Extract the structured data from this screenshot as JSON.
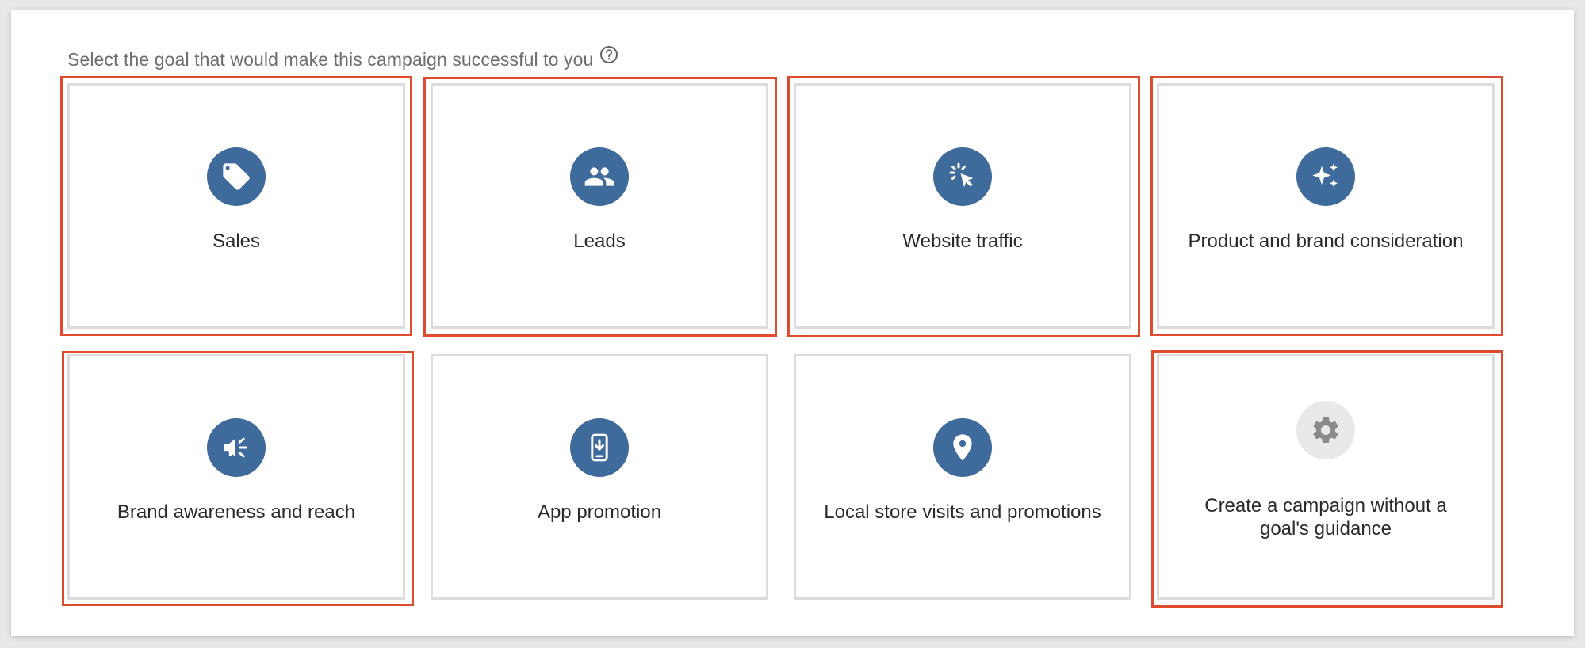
{
  "heading": {
    "text": "Select the goal that would make this campaign successful to you",
    "help_icon": "help-circle-icon"
  },
  "goals": [
    {
      "label": "Sales",
      "icon": "tag-icon",
      "highlighted": true
    },
    {
      "label": "Leads",
      "icon": "people-icon",
      "highlighted": true
    },
    {
      "label": "Website traffic",
      "icon": "cursor-click-icon",
      "highlighted": true
    },
    {
      "label": "Product and brand consideration",
      "icon": "sparkle-icon",
      "highlighted": true
    },
    {
      "label": "Brand awareness and reach",
      "icon": "megaphone-icon",
      "highlighted": true
    },
    {
      "label": "App promotion",
      "icon": "phone-download-icon",
      "highlighted": false
    },
    {
      "label": "Local store visits and promotions",
      "icon": "location-pin-icon",
      "highlighted": false
    },
    {
      "label": "Create a campaign without a goal's guidance",
      "icon": "gear-icon",
      "highlighted": true
    }
  ],
  "colors": {
    "icon_background": "#3f6a9c",
    "neutral_icon_background": "#e9e9e9",
    "highlight_border": "#e04a2f",
    "card_border": "#dcdcdc"
  }
}
